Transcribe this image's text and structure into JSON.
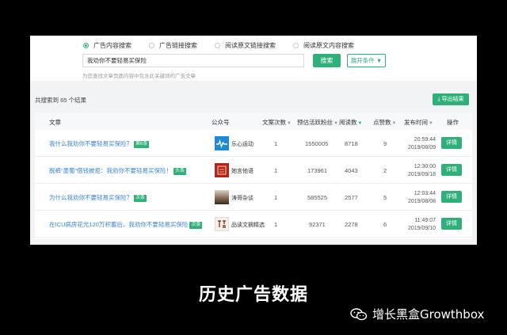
{
  "search_panel": {
    "modes": [
      {
        "label": "广告内容搜索",
        "checked": true
      },
      {
        "label": "广告链接搜索",
        "checked": false
      },
      {
        "label": "阅读原文链接搜索",
        "checked": false
      },
      {
        "label": "阅读原文内容搜索",
        "checked": false
      }
    ],
    "query": "我劝你不要轻易买保险",
    "search_button": "搜索",
    "expand_button": "展开条件 ▼",
    "hint": "为您查找文章页面内容中包含此关键词的广告文章"
  },
  "results": {
    "summary": "共搜索到 65 个结果",
    "export_button": "导出结果"
  },
  "table": {
    "headers": {
      "article": "文章",
      "account": "公众号",
      "ad_count": "文案次数",
      "fans": "预估活跃粉丝",
      "reads": "阅读数",
      "likes": "点赞数",
      "publish_time": "发布时间",
      "action": "操作"
    },
    "rows": [
      {
        "title": "我什么我劝你不要轻易买保险？",
        "tag": "第6条",
        "account": "乐心运动",
        "avatar": "blue",
        "ad_count": "1",
        "fans": "1550005",
        "reads": "8718",
        "likes": "9",
        "time": "20:59:44",
        "date": "2019/08/09",
        "action": "详情"
      },
      {
        "title": "脱裤“墨葡”借钱被拒：我劝你不要轻易买保险！",
        "tag": "头条",
        "account": "她言他语",
        "avatar": "red",
        "ad_count": "1",
        "fans": "173961",
        "reads": "4043",
        "likes": "2",
        "time": "12:30:00",
        "date": "2019/09/18",
        "action": "详情"
      },
      {
        "title": "为什么我劝你不要轻易买保险？",
        "tag": "次条",
        "account": "涛哥杂谈",
        "avatar": "photo",
        "ad_count": "1",
        "fans": "585525",
        "reads": "2577",
        "likes": "5",
        "time": "12:03:44",
        "date": "2019/08/08",
        "action": "详情"
      },
      {
        "title": "在ICU病房花光120万积蓄后，我劝你不要轻易买保险",
        "tag": "次条",
        "account": "品读文摘精选",
        "avatar": "ink",
        "ad_count": "1",
        "fans": "92371",
        "reads": "2278",
        "likes": "6",
        "time": "11:49:07",
        "date": "2019/09/10",
        "action": "详情"
      }
    ]
  },
  "caption": "历史广告数据",
  "watermark": "增长黑盒Growthbox",
  "colors": {
    "accent": "#2fb079",
    "link": "#3b86d4"
  }
}
